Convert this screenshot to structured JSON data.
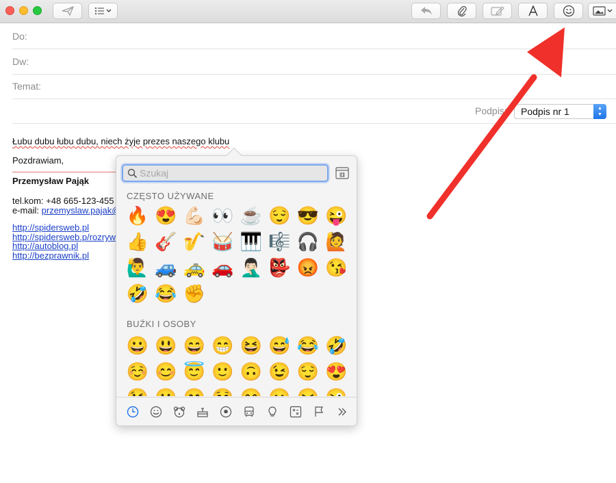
{
  "header": {
    "to_label": "Do:",
    "cc_label": "Dw:",
    "subject_label": "Temat:",
    "signature_label": "Podpis:",
    "signature_value": "Podpis nr 1"
  },
  "body": {
    "line1": "Łubu dubu łubu dubu, niech żyje prezes naszego klubu",
    "greeting": "Pozdrawiam,",
    "name": "Przemysław Pająk",
    "phone": "tel.kom: +48 665-123-455",
    "email_label": "e-mail:",
    "email_value": "przemyslaw.pajak@g",
    "links": [
      "http://spidersweb.pl",
      "http://spidersweb.p/rozrywka",
      "http://autoblog.pl",
      "http://bezprawnik.pl"
    ]
  },
  "emoji_picker": {
    "search_placeholder": "Szukaj",
    "section_frequent": "CZĘSTO UŻYWANE",
    "frequent": [
      "🔥",
      "😍",
      "💪🏻",
      "👀",
      "☕",
      "😌",
      "😎",
      "😜",
      "👍",
      "🎸",
      "🎷",
      "🥁",
      "🎹",
      "🎼",
      "🎧",
      "🙋",
      "🙋‍♂️",
      "🚙",
      "🚕",
      "🚗",
      "🤦🏻‍♂️",
      "👺",
      "😡",
      "😘",
      "🤣",
      "😂",
      "✊"
    ],
    "section_people": "BUŹKI I OSOBY",
    "people": [
      "😀",
      "😃",
      "😄",
      "😁",
      "😆",
      "😅",
      "😂",
      "🤣",
      "☺️",
      "😊",
      "😇",
      "🙂",
      "🙃",
      "😉",
      "😌",
      "😍",
      "😘",
      "😗",
      "😙",
      "😚",
      "😋",
      "😛",
      "😝",
      "😜"
    ]
  },
  "colors": {
    "accent": "#1f74e8",
    "arrow": "#f0302a",
    "link": "#1a3fc8"
  }
}
